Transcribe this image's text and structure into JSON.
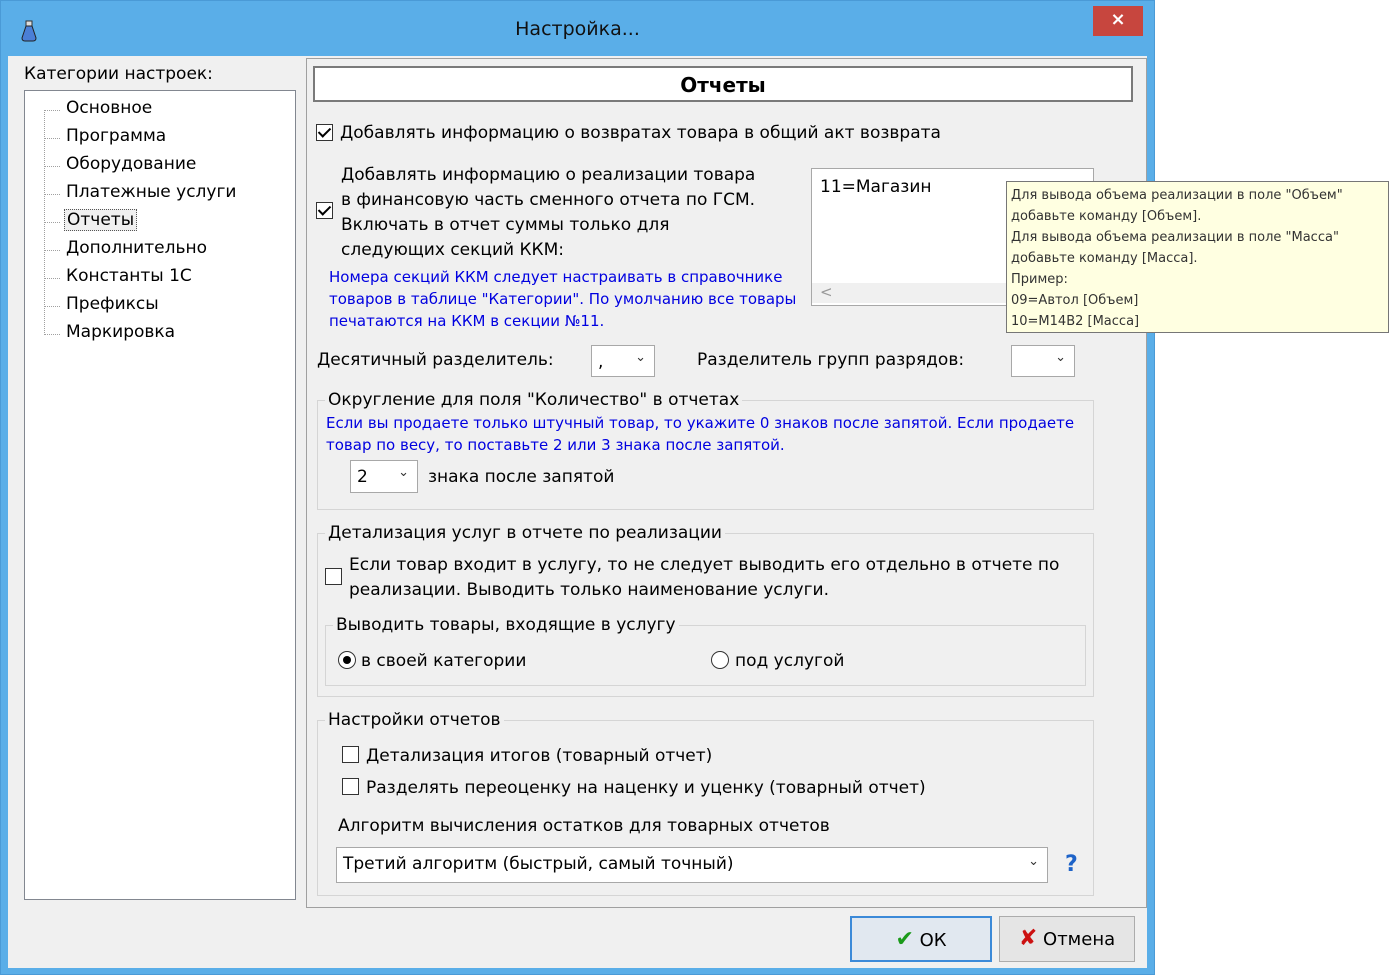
{
  "window": {
    "title": "Настройка...",
    "close_label": "×"
  },
  "left": {
    "label": "Категории настроек:",
    "items": [
      "Основное",
      "Программа",
      "Оборудование",
      "Платежные услуги",
      "Отчеты",
      "Дополнительно",
      "Константы 1С",
      "Префиксы",
      "Маркировка"
    ],
    "selected": "Отчеты"
  },
  "section": {
    "title": "Отчеты"
  },
  "returns": {
    "label": "Добавлять информацию о возвратах товара в общий акт возврата",
    "checked": true
  },
  "sales": {
    "line1": "Добавлять информацию о реализации товара",
    "line2": "в финансовую часть сменного отчета по ГСМ.",
    "line3": "Включать в отчет суммы только для",
    "line4": "следующих секций ККМ:",
    "checked": true,
    "hint1": "Номера секций ККМ следует настраивать в справочнике",
    "hint2": "товаров в таблице \"Категории\". По умолчанию все товары",
    "hint3": "печатаются на ККМ в секции №11.",
    "list_value": "11=Магазин"
  },
  "tooltip": {
    "line1": "Для вывода объема реализации в поле \"Объем\"",
    "line2": "добавьте команду [Объем].",
    "line3": "Для вывода объема реализации в поле \"Масса\"",
    "line4": "добавьте команду [Масса].",
    "line5": "Пример:",
    "line6": "09=Автол [Объем]",
    "line7": "10=М14В2 [Масса]"
  },
  "separators": {
    "decimal_label": "Десятичный разделитель:",
    "decimal_value": ",",
    "group_label": "Разделитель групп разрядов:",
    "group_value": ""
  },
  "rounding": {
    "group_title": "Округление для поля \"Количество\" в отчетах",
    "hint1": "Если вы продаете только штучный товар, то укажите 0 знаков после запятой. Если продаете",
    "hint2": "товар по весу, то поставьте 2 или 3 знака после запятой.",
    "value": "2",
    "suffix": "знака после запятой"
  },
  "services": {
    "group_title": "Детализация услуг в отчете по реализации",
    "checkbox_line1": "Если товар входит в услугу, то не следует выводить его отдельно в отчете по",
    "checkbox_line2": "реализации. Выводить только наименование услуги.",
    "checked": false,
    "sub_title": "Выводить товары, входящие в услугу",
    "radio1": "в своей категории",
    "radio2": "под услугой",
    "selected": "в своей категории"
  },
  "report_settings": {
    "group_title": "Настройки отчетов",
    "cb1": "Детализация итогов (товарный отчет)",
    "cb2": "Разделять переоценку на наценку и уценку (товарный отчет)",
    "algo_label": "Алгоритм вычисления остатков для товарных отчетов",
    "algo_value": "Третий алгоритм (быстрый, самый точный)",
    "help": "?"
  },
  "buttons": {
    "ok": "ОК",
    "cancel": "Отмена"
  },
  "colors": {
    "titlebar": "#5aaee8",
    "close": "#c7463e",
    "hint_text": "#0000e0",
    "tooltip_bg": "#ffffe1"
  }
}
